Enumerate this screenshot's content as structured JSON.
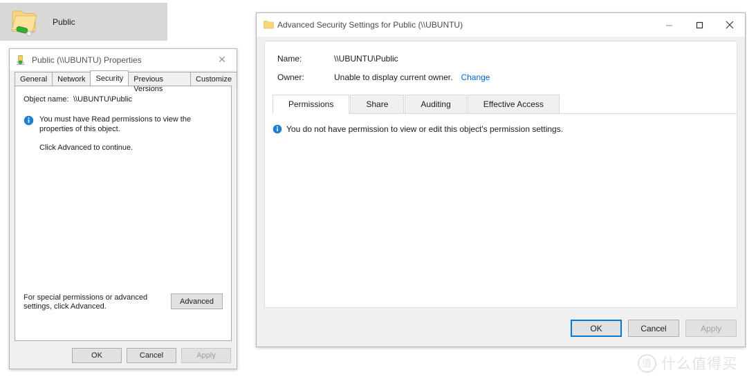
{
  "folder_item": {
    "label": "Public",
    "icon": "shared-folder-icon"
  },
  "properties_window": {
    "title": "Public (\\\\UBUNTU) Properties",
    "title_icon": "network-drive-icon",
    "close_icon": "✕",
    "tabs": [
      {
        "label": "General",
        "active": false
      },
      {
        "label": "Network",
        "active": false
      },
      {
        "label": "Security",
        "active": true
      },
      {
        "label": "Previous Versions",
        "active": false
      },
      {
        "label": "Customize",
        "active": false
      }
    ],
    "object_name_label": "Object name:",
    "object_name_value": "\\\\UBUNTU\\Public",
    "info_icon": "info-icon",
    "info_text": "You must have Read permissions to view the properties of this object.",
    "sub_note": "Click Advanced to continue.",
    "advanced_hint": "For special permissions or advanced settings, click Advanced.",
    "advanced_button": "Advanced",
    "footer": {
      "ok": "OK",
      "cancel": "Cancel",
      "apply": "Apply"
    }
  },
  "advanced_window": {
    "title": "Advanced Security Settings for Public (\\\\UBUNTU)",
    "title_icon": "folder-icon",
    "caption": {
      "minimize": "minimize-icon",
      "maximize": "maximize-icon",
      "close": "close-icon"
    },
    "name_label": "Name:",
    "name_value": "\\\\UBUNTU\\Public",
    "owner_label": "Owner:",
    "owner_value": "Unable to display current owner.",
    "owner_change_link": "Change",
    "tabs": [
      {
        "label": "Permissions",
        "active": true
      },
      {
        "label": "Share",
        "active": false
      },
      {
        "label": "Auditing",
        "active": false
      },
      {
        "label": "Effective Access",
        "active": false
      }
    ],
    "notice_icon": "info-icon",
    "notice_text": "You do not have permission to view or edit this object's permission settings.",
    "footer": {
      "ok": "OK",
      "cancel": "Cancel",
      "apply": "Apply"
    }
  },
  "watermark": {
    "badge": "值",
    "text": "什么值得买"
  },
  "colors": {
    "accent": "#0078d7",
    "link": "#0066cc",
    "info": "#1e7fd4",
    "folder": "#f7d478",
    "share_cable": "#3aaa35",
    "window_bg": "#f0f0f0",
    "selection_bg": "#d8d8d8"
  }
}
